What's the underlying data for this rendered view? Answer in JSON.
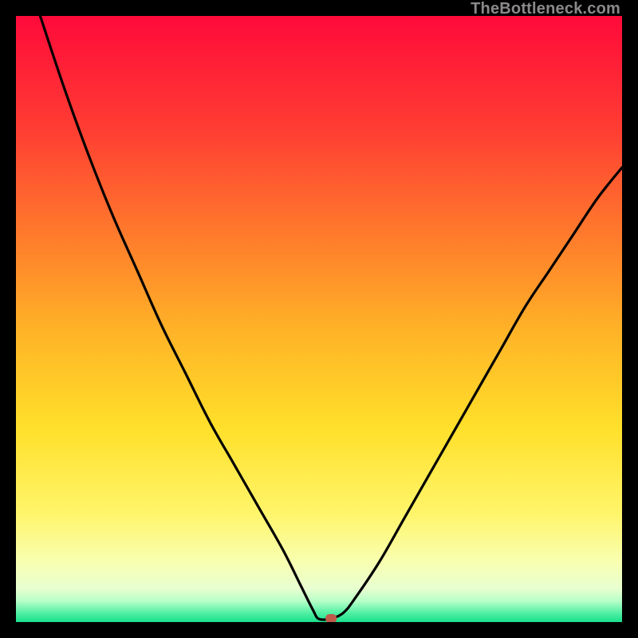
{
  "watermark": "TheBottleneck.com",
  "chart_data": {
    "type": "line",
    "title": "",
    "xlabel": "",
    "ylabel": "",
    "xlim": [
      0,
      100
    ],
    "ylim": [
      0,
      100
    ],
    "grid": false,
    "legend": false,
    "gradient_stops": [
      {
        "pos": 0.0,
        "color": "#ff0a3a"
      },
      {
        "pos": 0.18,
        "color": "#ff3b33"
      },
      {
        "pos": 0.36,
        "color": "#ff7a2c"
      },
      {
        "pos": 0.52,
        "color": "#ffb327"
      },
      {
        "pos": 0.68,
        "color": "#ffe02a"
      },
      {
        "pos": 0.82,
        "color": "#fff56a"
      },
      {
        "pos": 0.9,
        "color": "#f8ffb0"
      },
      {
        "pos": 0.945,
        "color": "#e8ffd0"
      },
      {
        "pos": 0.965,
        "color": "#b8ffc8"
      },
      {
        "pos": 0.985,
        "color": "#52f0a4"
      },
      {
        "pos": 1.0,
        "color": "#18e08c"
      }
    ],
    "curve_left": {
      "x": [
        4,
        8,
        12,
        16,
        20,
        24,
        28,
        32,
        36,
        40,
        44,
        47,
        49,
        50,
        52
      ],
      "y": [
        100,
        88,
        77,
        67,
        58,
        49,
        41,
        33,
        26,
        19,
        12,
        6,
        2,
        0.5,
        0.5
      ]
    },
    "curve_right": {
      "x": [
        52,
        54,
        56,
        60,
        64,
        68,
        72,
        76,
        80,
        84,
        88,
        92,
        96,
        100
      ],
      "y": [
        0.5,
        1.5,
        4,
        10,
        17,
        24,
        31,
        38,
        45,
        52,
        58,
        64,
        70,
        75
      ]
    },
    "marker": {
      "x": 52,
      "y": 0.6,
      "color": "#c05a4a"
    }
  }
}
